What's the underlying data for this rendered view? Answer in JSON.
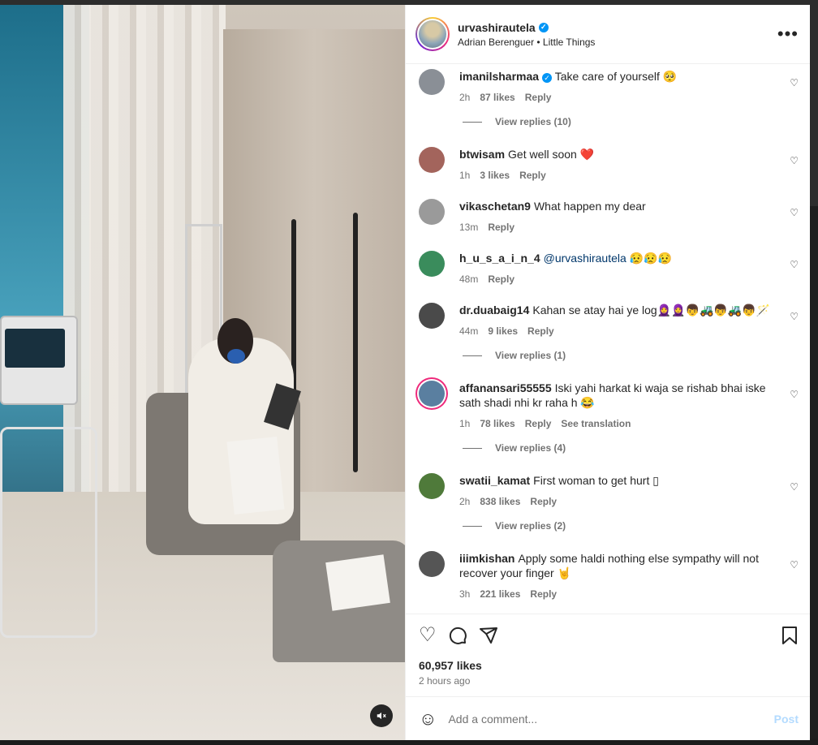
{
  "post": {
    "username": "urvashirautela",
    "audio": "Adrian Berenguer • Little Things",
    "likes": "60,957 likes",
    "time": "2 hours ago"
  },
  "comments": [
    {
      "user": "imanilsharmaa",
      "verified": true,
      "text": "Take care of yourself 🥺",
      "time": "2h",
      "likes": "87 likes",
      "reply": "Reply",
      "view_replies": "View replies (10)",
      "avatar": "#8a8f96"
    },
    {
      "user": "btwisam",
      "text": "Get well soon ❤️",
      "time": "1h",
      "likes": "3 likes",
      "reply": "Reply",
      "avatar": "#a3645c"
    },
    {
      "user": "vikaschetan9",
      "text": "What happen my dear",
      "time": "13m",
      "reply": "Reply",
      "avatar": "#9a9a9a"
    },
    {
      "user": "h_u_s_a_i_n_4",
      "mention": "@urvashirautela",
      "text": " 😥😥😥",
      "time": "48m",
      "reply": "Reply",
      "avatar": "#3a8c5c"
    },
    {
      "user": "dr.duabaig14",
      "text": "Kahan se atay hai ye log🧕🧕👦🚜👦🚜👦🪄",
      "time": "44m",
      "likes": "9 likes",
      "reply": "Reply",
      "view_replies": "View replies (1)",
      "avatar": "#4a4a4a"
    },
    {
      "user": "affanansari55555",
      "text": "Iski yahi harkat ki waja se rishab bhai iske sath shadi nhi kr raha h 😂",
      "time": "1h",
      "likes": "78 likes",
      "reply": "Reply",
      "translate": "See translation",
      "view_replies": "View replies (4)",
      "avatar": "#5a7fa0",
      "ring": true
    },
    {
      "user": "swatii_kamat",
      "text": "First woman to get hurt ▯",
      "time": "2h",
      "likes": "838 likes",
      "reply": "Reply",
      "view_replies": "View replies (2)",
      "avatar": "#4f7a3a"
    },
    {
      "user": "iiimkishan",
      "text": "Apply some haldi nothing else sympathy will not recover your finger 🤘",
      "time": "3h",
      "likes": "221 likes",
      "reply": "Reply",
      "avatar": "#555"
    }
  ],
  "add_comment": {
    "placeholder": "Add a comment...",
    "post_label": "Post"
  }
}
